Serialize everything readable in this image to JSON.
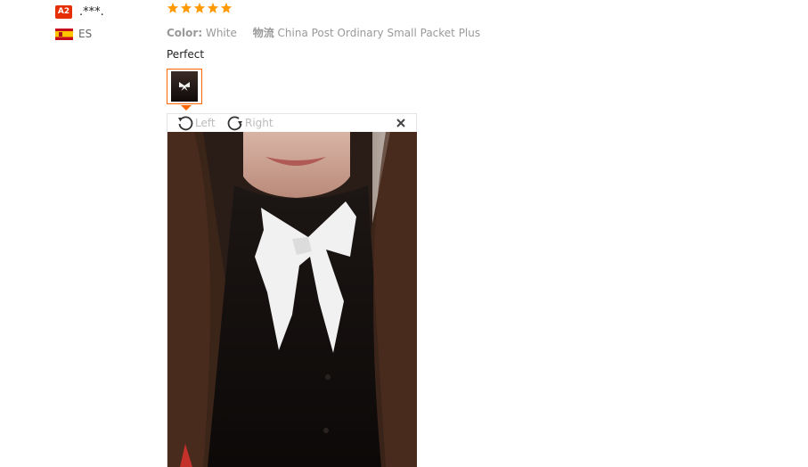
{
  "reviewer": {
    "level_badge": "A2",
    "name": ".***.",
    "country_code": "ES"
  },
  "review": {
    "rating": 5,
    "rating_max": 5,
    "color_label": "Color:",
    "color_value": "White",
    "shipping_label": "物流",
    "shipping_value": "China Post Ordinary Small Packet Plus",
    "text": "Perfect"
  },
  "viewer": {
    "rotate_left_label": "Left",
    "rotate_right_label": "Right"
  },
  "colors": {
    "star": "#ff9a00",
    "badge": "#e62e04",
    "thumb_border": "#ff6600"
  }
}
